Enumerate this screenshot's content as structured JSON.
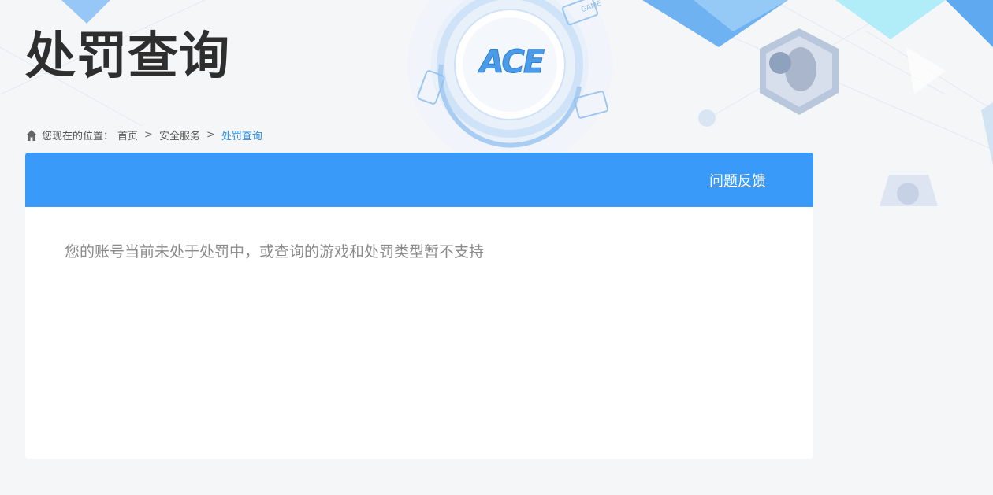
{
  "header": {
    "title": "处罚查询"
  },
  "breadcrumb": {
    "prefix": "您现在的位置：",
    "items": [
      "首页",
      "安全服务"
    ],
    "separator": ">",
    "current": "处罚查询"
  },
  "panel": {
    "feedback_label": "问题反馈",
    "message": "您的账号当前未处于处罚中，或查询的游戏和处罚类型暂不支持"
  },
  "logo": {
    "text": "ACE"
  },
  "decor": {
    "game_badge": "GAME"
  },
  "colors": {
    "accent": "#3a9af9",
    "link": "#2a8ee8",
    "title": "#2e2e2e",
    "message": "#8a8a8a",
    "background": "#f5f6f7"
  }
}
